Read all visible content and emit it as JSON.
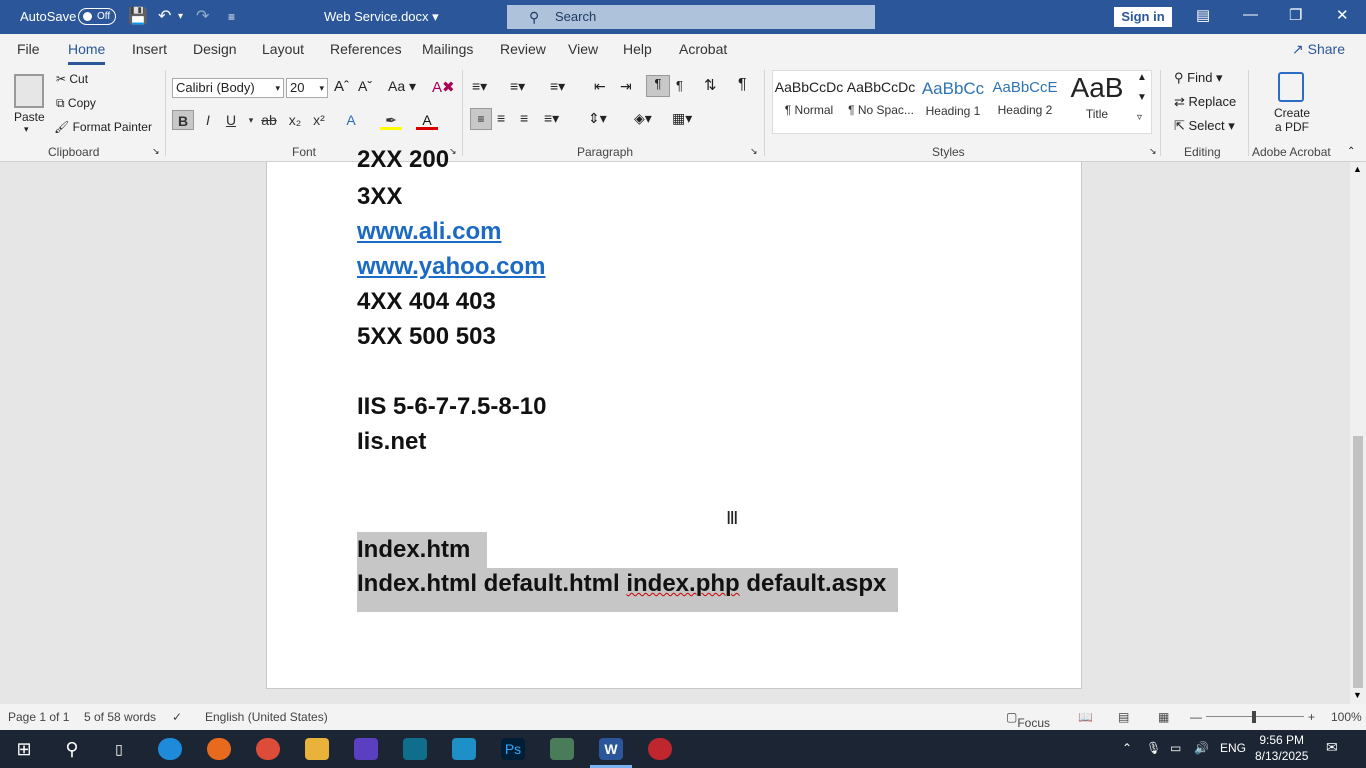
{
  "titlebar": {
    "autosave_label": "AutoSave",
    "autosave_state": "Off",
    "doc_title": "Web Service.docx",
    "search_placeholder": "Search",
    "signin": "Sign in"
  },
  "tabs": [
    "File",
    "Home",
    "Insert",
    "Design",
    "Layout",
    "References",
    "Mailings",
    "Review",
    "View",
    "Help",
    "Acrobat"
  ],
  "active_tab": "Home",
  "share": "Share",
  "clipboard": {
    "paste": "Paste",
    "cut": "Cut",
    "copy": "Copy",
    "format_painter": "Format Painter",
    "label": "Clipboard"
  },
  "font": {
    "name": "Calibri (Body)",
    "size": "20",
    "label": "Font"
  },
  "paragraph": {
    "label": "Paragraph"
  },
  "styles": {
    "label": "Styles",
    "items": [
      {
        "sample": "AaBbCcDc",
        "name": "¶ Normal"
      },
      {
        "sample": "AaBbCcDc",
        "name": "¶ No Spac..."
      },
      {
        "sample": "AaBbCc",
        "name": "Heading 1"
      },
      {
        "sample": "AaBbCcE",
        "name": "Heading 2"
      },
      {
        "sample": "AaB",
        "name": "Title"
      }
    ]
  },
  "editing": {
    "find": "Find",
    "replace": "Replace",
    "select": "Select",
    "label": "Editing"
  },
  "acrobat": {
    "create_pdf_line1": "Create",
    "create_pdf_line2": "a PDF",
    "label": "Adobe Acrobat"
  },
  "document": {
    "lines": [
      "2XX 200",
      "3XX",
      "www.ali.com",
      "www.yahoo.com",
      "4XX 404 403",
      "5XX 500 503",
      "IIS 5-6-7-7.5-8-10",
      "Iis.net",
      "Index.htm",
      "Index.html default.html ",
      "index.php",
      " default.aspx"
    ]
  },
  "status": {
    "page": "Page 1 of 1",
    "words": "5 of 58 words",
    "language": "English (United States)",
    "focus": "Focus",
    "zoom": "100%"
  },
  "taskbar": {
    "lang": "ENG",
    "time": "9:56 PM",
    "date": "8/13/2025"
  }
}
